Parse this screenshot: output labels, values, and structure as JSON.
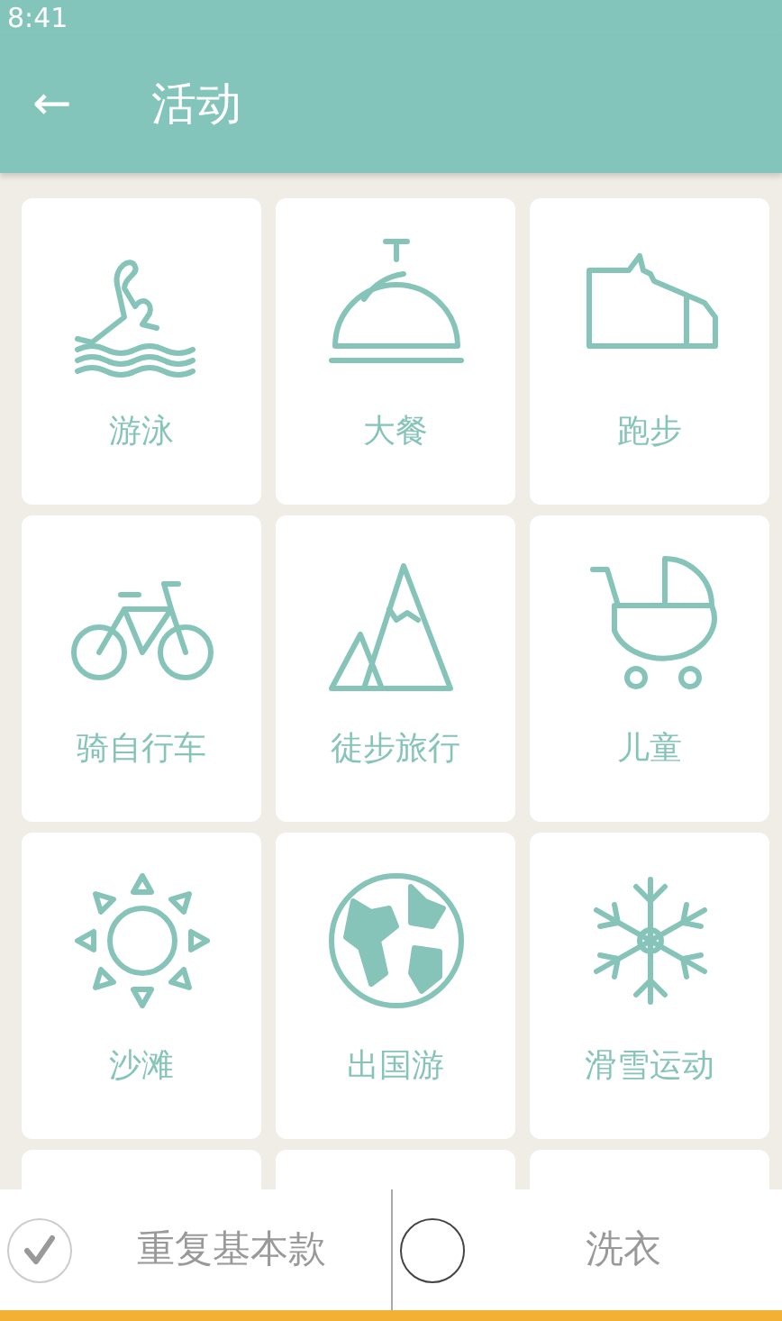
{
  "status_bar": {
    "time": "8:41"
  },
  "app_bar": {
    "back": "←",
    "title": "活动"
  },
  "tiles": [
    {
      "kind": "activity",
      "label": "游泳"
    },
    {
      "kind": "activity",
      "label": "大餐"
    },
    {
      "kind": "activity",
      "label": "跑步"
    },
    {
      "kind": "activity",
      "label": "骑自行车"
    },
    {
      "kind": "activity",
      "label": "徒步旅行"
    },
    {
      "kind": "activity",
      "label": "儿童"
    },
    {
      "kind": "activity",
      "label": "沙滩"
    },
    {
      "kind": "activity",
      "label": "出国游"
    },
    {
      "kind": "activity",
      "label": "滑雪运动"
    },
    {
      "kind": "blank"
    },
    {
      "kind": "blank"
    },
    {
      "kind": "blank"
    }
  ],
  "bottom_options": [
    {
      "label": "重复基本款",
      "checked": true
    },
    {
      "label": "洗衣",
      "checked": false
    }
  ]
}
